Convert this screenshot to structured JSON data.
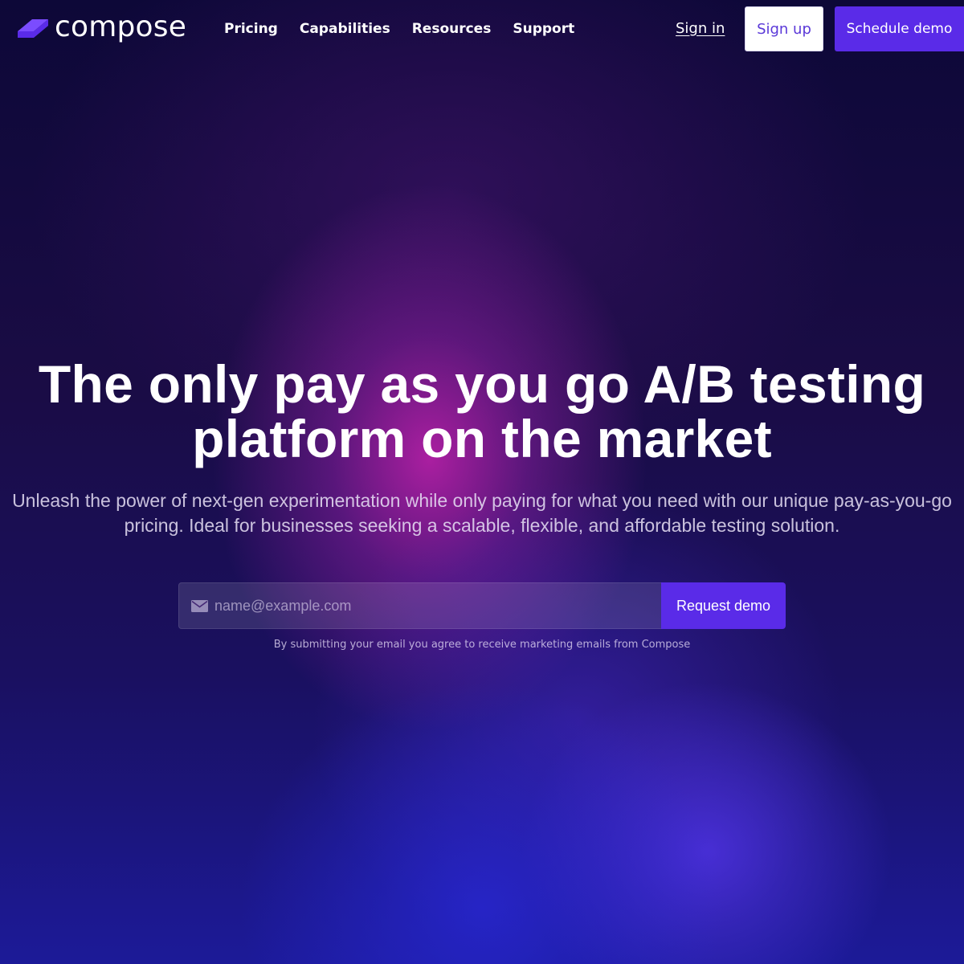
{
  "brand": {
    "name": "compose",
    "logo_icon": "compose-logo-mark",
    "accent_color": "#5a2be8"
  },
  "nav": {
    "links": [
      {
        "label": "Pricing"
      },
      {
        "label": "Capabilities"
      },
      {
        "label": "Resources"
      },
      {
        "label": "Support"
      }
    ],
    "sign_in": "Sign in",
    "sign_up": "Sign up",
    "schedule_demo": "Schedule demo"
  },
  "hero": {
    "title_line_1": "The only pay as you go A/B testing",
    "title_line_2": "platform on the market",
    "subtitle": "Unleash the power of next-gen experimentation while only paying for what you need with our unique pay-as-you-go pricing. Ideal for businesses seeking a scalable, flexible, and affordable testing solution."
  },
  "form": {
    "email_icon": "envelope-icon",
    "email_placeholder": "name@example.com",
    "email_value": "",
    "submit_label": "Request demo",
    "disclaimer": "By submitting your email you agree to receive marketing emails from Compose"
  }
}
